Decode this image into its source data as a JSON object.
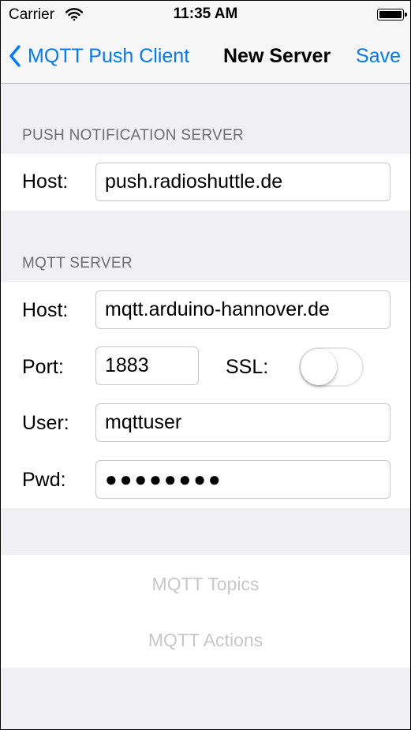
{
  "status_bar": {
    "carrier": "Carrier",
    "time": "11:35 AM",
    "wifi_icon": "wifi-icon",
    "battery_icon": "battery-icon"
  },
  "nav": {
    "back_label": "MQTT Push Client",
    "back_icon": "chevron-left-icon",
    "title": "New Server",
    "save_label": "Save",
    "tint_color": "#007aff"
  },
  "push_section": {
    "header": "PUSH NOTIFICATION SERVER",
    "host_label": "Host:",
    "host_value": "push.radioshuttle.de"
  },
  "mqtt_section": {
    "header": "MQTT SERVER",
    "host_label": "Host:",
    "host_value": "mqtt.arduino-hannover.de",
    "port_label": "Port:",
    "port_value": "1883",
    "ssl_label": "SSL:",
    "ssl_enabled": false,
    "user_label": "User:",
    "user_value": "mqttuser",
    "pwd_label": "Pwd:",
    "pwd_value": "●●●●●●●●"
  },
  "actions": {
    "topics_label": "MQTT Topics",
    "actions_label": "MQTT Actions",
    "disabled_color": "#c7c7cc"
  }
}
